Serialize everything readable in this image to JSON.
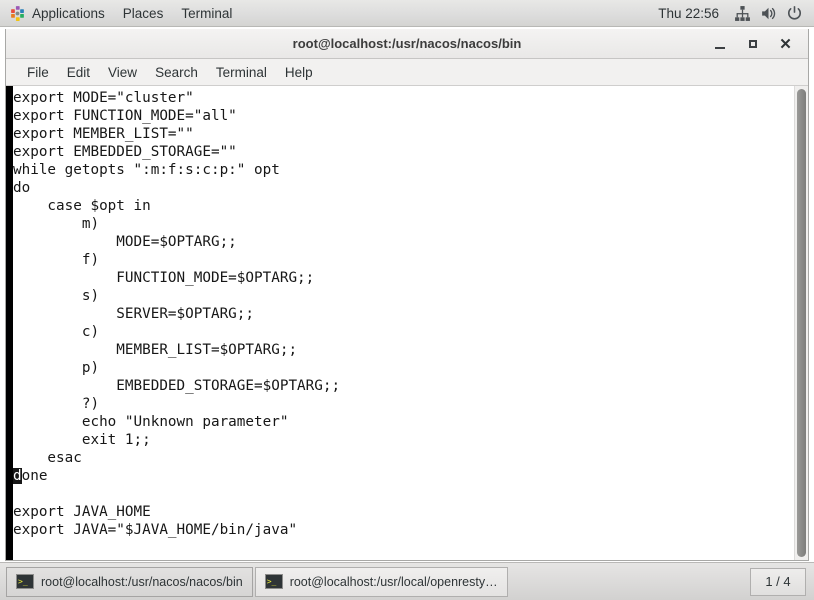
{
  "top_panel": {
    "app_icon_name": "applications-logo-icon",
    "menus": [
      {
        "label": "Applications"
      },
      {
        "label": "Places"
      },
      {
        "label": "Terminal"
      }
    ],
    "clock": "Thu 22:56",
    "tray_icons": [
      {
        "name": "network-icon"
      },
      {
        "name": "volume-icon"
      },
      {
        "name": "power-icon"
      }
    ]
  },
  "window": {
    "title": "root@localhost:/usr/nacos/nacos/bin",
    "buttons": {
      "minimize": "–",
      "maximize": "□",
      "close": "✕"
    },
    "menubar": [
      {
        "label": "File"
      },
      {
        "label": "Edit"
      },
      {
        "label": "View"
      },
      {
        "label": "Search"
      },
      {
        "label": "Terminal"
      },
      {
        "label": "Help"
      }
    ]
  },
  "terminal": {
    "lines_before_cursor": "export MODE=\"cluster\"\nexport FUNCTION_MODE=\"all\"\nexport MEMBER_LIST=\"\"\nexport EMBEDDED_STORAGE=\"\"\nwhile getopts \":m:f:s:c:p:\" opt\ndo\n    case $opt in\n        m)\n            MODE=$OPTARG;;\n        f)\n            FUNCTION_MODE=$OPTARG;;\n        s)\n            SERVER=$OPTARG;;\n        c)\n            MEMBER_LIST=$OPTARG;;\n        p)\n            EMBEDDED_STORAGE=$OPTARG;;\n        ?)\n        echo \"Unknown parameter\"\n        exit 1;;\n    esac\n",
    "cursor_char": "d",
    "lines_after_cursor": "one\n\nexport JAVA_HOME\nexport JAVA=\"$JAVA_HOME/bin/java\"",
    "scrollbar": {
      "name": "vertical-scrollbar"
    }
  },
  "taskbar": {
    "tasks": [
      {
        "label": "root@localhost:/usr/nacos/nacos/bin",
        "active": true,
        "icon": "terminal-icon"
      },
      {
        "label": "root@localhost:/usr/local/openresty…",
        "active": false,
        "icon": "terminal-icon"
      }
    ],
    "workspace": "1 / 4"
  }
}
